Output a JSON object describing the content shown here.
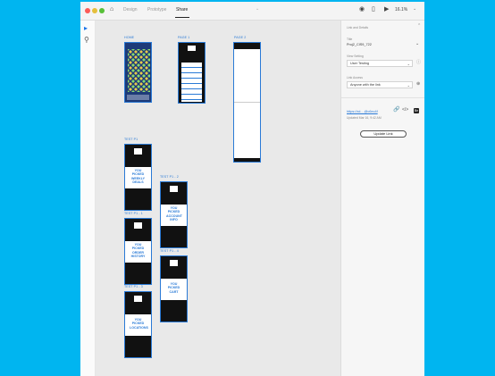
{
  "window": {
    "tabs": [
      {
        "label": "Design",
        "active": false
      },
      {
        "label": "Prototype",
        "active": false
      },
      {
        "label": "Share",
        "active": true
      }
    ],
    "zoom": "16.1%"
  },
  "artboards": {
    "home": "HOME",
    "page1": "PAGE 1",
    "page2": "PAGE 2",
    "test1": "TEST P1",
    "test1_title": "YOU PICKED WEEKLY DEALS",
    "test2": "TEST P1 - 2",
    "test2_title": "YOU PICKED ACCOUNT INFO",
    "test3": "TEST P1 - 1",
    "test3_title": "YOU PICKED ORDER HISTORY",
    "test4": "TEST P1 - 4",
    "test4_title": "YOU PICKED CART",
    "test5": "TEST P1 - 3",
    "test5_title": "YOU PICKED LOCATIONS"
  },
  "share_panel": {
    "heading": "Link and Details",
    "title_label": "Title",
    "title_value": "Proj2_CIS9_722",
    "viewsetting_label": "View Setting",
    "viewsetting_value": "User Testing",
    "linkaccess_label": "Link Access",
    "linkaccess_value": "Anyone with the link",
    "link": "https://xd....@c6ec4f",
    "updated": "Updated Mar 16, 9:42 AM",
    "update_button": "Update Link"
  }
}
